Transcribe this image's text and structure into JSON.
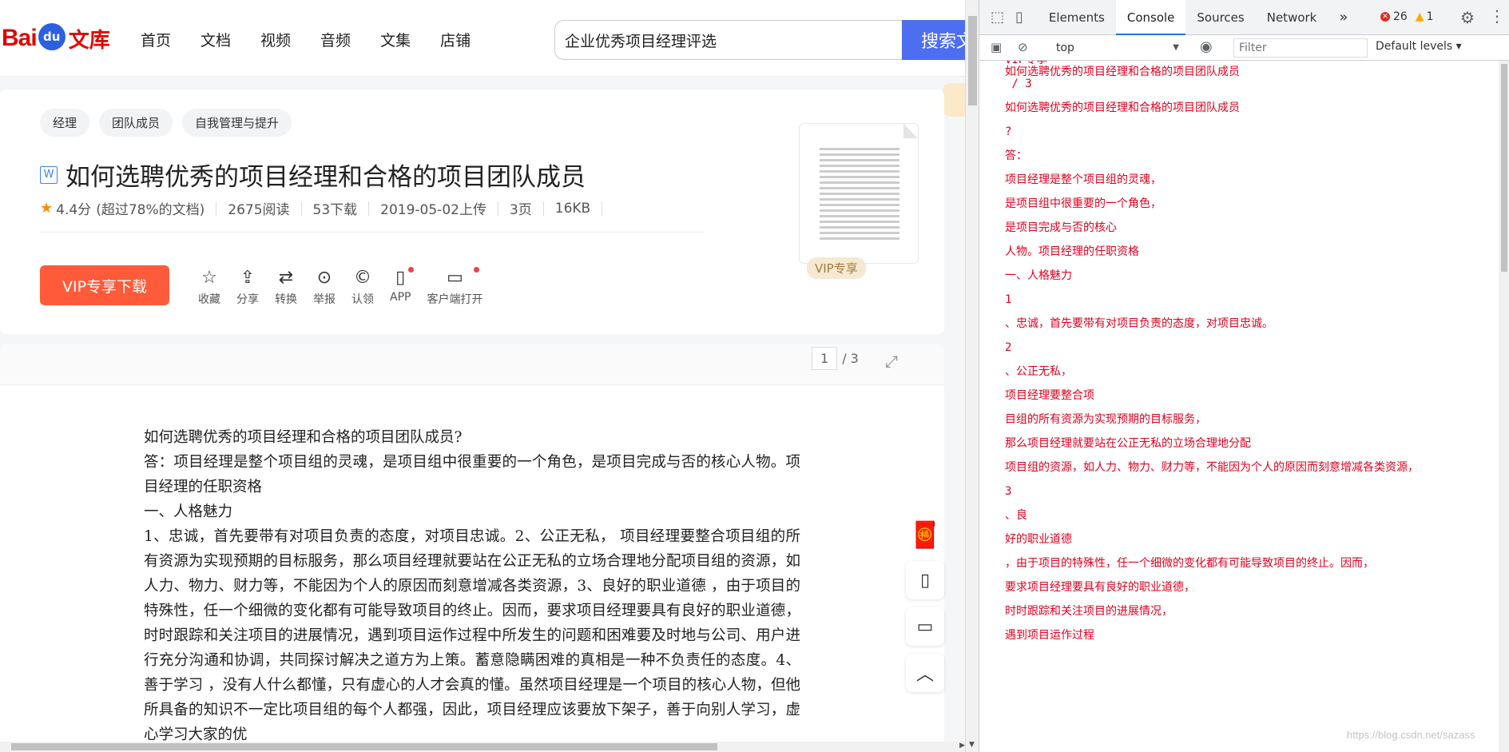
{
  "header": {
    "logo_left": "Bai",
    "logo_paw": "du",
    "logo_right": "文库",
    "nav": [
      "首页",
      "文档",
      "视频",
      "音频",
      "文集",
      "店铺"
    ],
    "search_value": "企业优秀项目经理评选",
    "search_button": "搜索文"
  },
  "doc": {
    "tags": [
      "经理",
      "团队成员",
      "自我管理与提升"
    ],
    "type_icon": "W",
    "title": "如何选聘优秀的项目经理和合格的项目团队成员",
    "rating": "4.4分",
    "rating_note": "(超过78%的文档)",
    "reads": "2675阅读",
    "downloads": "53下载",
    "upload_date": "2019-05-02上传",
    "pages": "3页",
    "size": "16KB",
    "vip_download": "VIP专享下载",
    "actions": [
      {
        "icon": "☆",
        "label": "收藏"
      },
      {
        "icon": "⇪",
        "label": "分享"
      },
      {
        "icon": "⇄",
        "label": "转换"
      },
      {
        "icon": "⊙",
        "label": "举报"
      },
      {
        "icon": "©",
        "label": "认领"
      },
      {
        "icon": "▯",
        "label": "APP"
      },
      {
        "icon": "▭",
        "label": "客户端打开"
      }
    ],
    "thumb_badge": "VIP专享",
    "pager_current": "1",
    "pager_total": "/ 3",
    "body": [
      "如何选聘优秀的项目经理和合格的项目团队成员?",
      "答：项目经理是整个项目组的灵魂，是项目组中很重要的一个角色，是项目完成与否的核心人物。项目经理的任职资格",
      "一、人格魅力",
      "1、忠诚，首先要带有对项目负责的态度，对项目忠诚。2、公正无私， 项目经理要整合项目组的所有资源为实现预期的目标服务，那么项目经理就要站在公正无私的立场合理地分配项目组的资源，如人力、物力、财力等，不能因为个人的原因而刻意增减各类资源，3、良好的职业道德 ，由于项目的特殊性，任一个细微的变化都有可能导致项目的终止。因而，要求项目经理要具有良好的职业道德，时时跟踪和关注项目的进展情况，遇到项目运作过程中所发生的问题和困难要及时地与公司、用户进行充分沟通和协调，共同探讨解决之道方为上策。蓄意隐瞒困难的真相是一种不负责任的态度。4、善于学习 ，没有人什么都懂，只有虚心的人才会真的懂。虽然项目经理是一个项目的核心人物，但他所具备的知识不一定比项目组的每个人都强，因此，项目经理应该要放下架子，善于向别人学习，虚心学习大家的优"
    ]
  },
  "devtools": {
    "tabs": [
      "Elements",
      "Console",
      "Sources",
      "Network"
    ],
    "more": "»",
    "errors": "26",
    "warnings": "1",
    "context": "top",
    "filter_placeholder": "Filter",
    "levels": "Default levels ▾",
    "logs": [
      "VIP专享",
      "如何选聘优秀的项目经理和合格的项目团队成员",
      " / 3",
      "",
      "如何选聘优秀的项目经理和合格的项目团队成员",
      "",
      "?",
      "",
      "答：",
      "",
      "项目经理是整个项目组的灵魂，",
      "",
      "是项目组中很重要的一个角色，",
      "",
      "是项目完成与否的核心",
      "",
      "人物。项目经理的任职资格",
      "",
      "一、人格魅力",
      "",
      "1",
      "",
      "、忠诚，首先要带有对项目负责的态度，对项目忠诚。",
      "",
      "2",
      "",
      "、公正无私，",
      "",
      "项目经理要整合项",
      "",
      "目组的所有资源为实现预期的目标服务，",
      "",
      "那么项目经理就要站在公正无私的立场合理地分配",
      "",
      "项目组的资源，如人力、物力、财力等，不能因为个人的原因而刻意增减各类资源，",
      "",
      "3",
      "",
      "、良",
      "",
      "好的职业道德",
      "",
      "，由于项目的特殊性，任一个细微的变化都有可能导致项目的终止。因而，",
      "",
      "要求项目经理要具有良好的职业道德，",
      "",
      "时时跟踪和关注项目的进展情况，",
      "",
      "遇到项目运作过程"
    ],
    "watermark": "https://blog.csdn.net/sazass"
  }
}
